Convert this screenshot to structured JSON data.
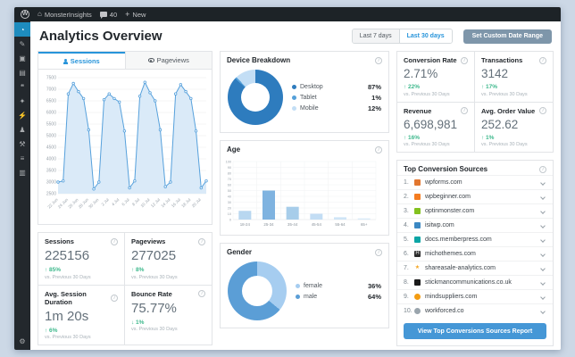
{
  "adminbar": {
    "wp": "W",
    "site": "MonsterInsights",
    "comments": "40",
    "new_label": "New"
  },
  "sidebar": {
    "items": [
      {
        "name": "menu-monsterinsights-dashboard",
        "glyph": "◔",
        "active": true
      },
      {
        "name": "menu-posts",
        "glyph": "✎",
        "active": false
      },
      {
        "name": "menu-media",
        "glyph": "▣",
        "active": false
      },
      {
        "name": "menu-pages",
        "glyph": "▤",
        "active": false
      },
      {
        "name": "menu-comments",
        "glyph": "❝",
        "active": false
      },
      {
        "name": "menu-appearance",
        "glyph": "✦",
        "active": false
      },
      {
        "name": "menu-plugins",
        "glyph": "⚡",
        "active": false
      },
      {
        "name": "menu-users",
        "glyph": "♟",
        "active": false
      },
      {
        "name": "menu-tools",
        "glyph": "⚒",
        "active": false
      },
      {
        "name": "menu-settings",
        "glyph": "≡",
        "active": false
      },
      {
        "name": "menu-insights-reports",
        "glyph": "▥",
        "active": false
      }
    ],
    "bottom": {
      "name": "menu-collapse-settings",
      "glyph": "⚙"
    }
  },
  "header": {
    "title": "Analytics Overview",
    "btn_7": "Last 7 days",
    "btn_30": "Last 30 days",
    "btn_custom": "Set Custom Date Range"
  },
  "tabs": {
    "sessions": "Sessions",
    "pageviews": "Pageviews"
  },
  "metrics_sub": "vs. Previous 30 Days",
  "metrics_left": [
    {
      "label": "Sessions",
      "value": "225156",
      "delta": "↑ 85%"
    },
    {
      "label": "Pageviews",
      "value": "277025",
      "delta": "↑ 8%"
    },
    {
      "label": "Avg. Session Duration",
      "value": "1m 20s",
      "delta": "↑ 6%"
    },
    {
      "label": "Bounce Rate",
      "value": "75.77%",
      "delta": "↓ 1%"
    }
  ],
  "metrics_right": [
    {
      "label": "Conversion Rate",
      "value": "2.71%",
      "delta": "↑ 22%"
    },
    {
      "label": "Transactions",
      "value": "3142",
      "delta": "↑ 17%"
    },
    {
      "label": "Revenue",
      "value": "6,698,981",
      "delta": "↑ 16%"
    },
    {
      "label": "Avg. Order Value",
      "value": "252.62",
      "delta": "↑ 1%"
    }
  ],
  "panels": {
    "device_title": "Device Breakdown",
    "age_title": "Age",
    "gender_title": "Gender",
    "sources_title": "Top Conversion Sources",
    "sources_button": "View Top Conversions Sources Report"
  },
  "sources": [
    {
      "rank": "1.",
      "domain": "wpforms.com",
      "fav_bg": "#e27730",
      "fav_glyph": "",
      "fav_color": "",
      "round": false
    },
    {
      "rank": "2.",
      "domain": "wpbeginner.com",
      "fav_bg": "#f47c20",
      "fav_glyph": "",
      "fav_color": "",
      "round": false
    },
    {
      "rank": "3.",
      "domain": "optinmonster.com",
      "fav_bg": "#83c11f",
      "fav_glyph": "",
      "fav_color": "",
      "round": false
    },
    {
      "rank": "4.",
      "domain": "isitwp.com",
      "fav_bg": "#3b88c3",
      "fav_glyph": "",
      "fav_color": "",
      "round": false
    },
    {
      "rank": "5.",
      "domain": "docs.memberpress.com",
      "fav_bg": "#0ca5a5",
      "fav_glyph": "",
      "fav_color": "",
      "round": false
    },
    {
      "rank": "6.",
      "domain": "michothemes.com",
      "fav_bg": "#2b2b2b",
      "fav_glyph": "H",
      "fav_color": "#ffffff",
      "round": false
    },
    {
      "rank": "7.",
      "domain": "shareasale-analytics.com",
      "fav_bg": "",
      "fav_glyph": "★",
      "fav_color": "#f5a623",
      "round": false
    },
    {
      "rank": "8.",
      "domain": "stickmancommunications.co.uk",
      "fav_bg": "#1a1a1a",
      "fav_glyph": "",
      "fav_color": "",
      "round": false
    },
    {
      "rank": "9.",
      "domain": "mindsuppliers.com",
      "fav_bg": "#f39c12",
      "fav_glyph": "",
      "fav_color": "",
      "round": true
    },
    {
      "rank": "10.",
      "domain": "workforced.co",
      "fav_bg": "#9aa5ad",
      "fav_glyph": "",
      "fav_color": "",
      "round": true
    }
  ],
  "chart_data": [
    {
      "type": "area",
      "title": "Sessions",
      "x": [
        "22 Jun",
        "23 Jun",
        "24 Jun",
        "25 Jun",
        "26 Jun",
        "27 Jun",
        "28 Jun",
        "29 Jun",
        "30 Jun",
        "1 Jul",
        "2 Jul",
        "3 Jul",
        "4 Jul",
        "5 Jul",
        "6 Jul",
        "7 Jul",
        "8 Jul",
        "9 Jul",
        "10 Jul",
        "11 Jul",
        "12 Jul",
        "13 Jul",
        "14 Jul",
        "15 Jul",
        "16 Jul",
        "17 Jul",
        "18 Jul",
        "19 Jul",
        "20 Jul",
        "21 Jul"
      ],
      "values": [
        3000,
        3050,
        6800,
        7250,
        6900,
        6600,
        5250,
        2700,
        3000,
        6550,
        6800,
        6600,
        6450,
        5200,
        2750,
        3050,
        6700,
        7300,
        6850,
        6500,
        5250,
        2800,
        3000,
        6800,
        7200,
        6900,
        6600,
        5200,
        2750,
        3050
      ],
      "ylim": [
        2500,
        7500
      ],
      "ytick_step": 500,
      "xtick_every": 2,
      "grid": true,
      "line_color": "#57a1dc",
      "fill_color": "#d3e6f7"
    },
    {
      "type": "pie",
      "title": "Device Breakdown",
      "labels": [
        "Desktop",
        "Tablet",
        "Mobile"
      ],
      "values": [
        87,
        1,
        12
      ],
      "colors": [
        "#2e7cbe",
        "#55a0d9",
        "#c3def5"
      ],
      "legend_position": "right"
    },
    {
      "type": "bar",
      "title": "Age",
      "categories": [
        "18-24",
        "25-34",
        "35-44",
        "45-54",
        "55-64",
        "65+"
      ],
      "values": [
        15,
        50,
        22,
        10,
        4,
        2
      ],
      "colors": [
        "#b8d7f0",
        "#7fb3e0",
        "#a7cdea",
        "#c3ddf4",
        "#cfe5f6",
        "#d8eaf8"
      ],
      "ylim": [
        0,
        100
      ],
      "ytick_step": 10,
      "grid": true
    },
    {
      "type": "pie",
      "title": "Gender",
      "labels": [
        "female",
        "male"
      ],
      "values": [
        36,
        64
      ],
      "colors": [
        "#a6cdf0",
        "#5b9ed6"
      ],
      "legend_position": "right"
    }
  ],
  "colors": {
    "accent_blue": "#2794da",
    "delta_green": "#3db88c",
    "active_menu": "#1e8cbe",
    "button_blue": "#4597d6",
    "custom_btn": "#7e96aa"
  }
}
